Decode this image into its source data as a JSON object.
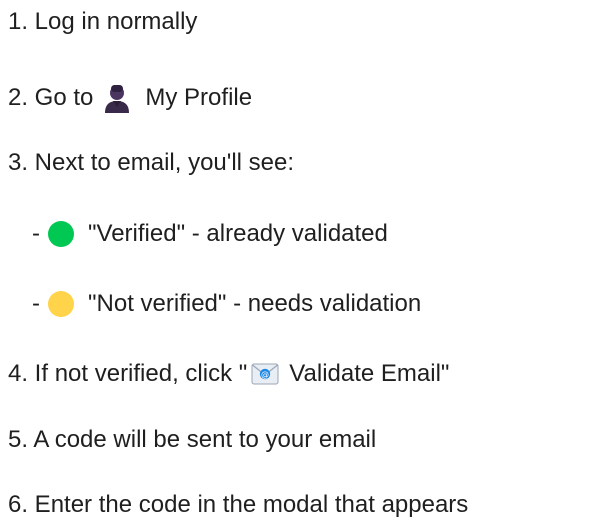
{
  "steps": [
    {
      "text": "1. Log in normally"
    },
    {
      "prefix": "2. Go to",
      "icon": "person-icon",
      "suffix": "My Profile"
    },
    {
      "text": "3. Next to email, you'll see:"
    },
    {
      "dash": "-",
      "icon": "green-dot-icon",
      "suffix": "\"Verified\" - already validated"
    },
    {
      "dash": "-",
      "icon": "yellow-dot-icon",
      "suffix": "\"Not verified\" - needs validation"
    },
    {
      "prefix": "4. If not verified, click \"",
      "icon": "envelope-icon",
      "suffix": "Validate Email\""
    },
    {
      "text": "5. A code will be sent to your email"
    },
    {
      "text": "6. Enter the code in the modal that appears"
    }
  ],
  "colors": {
    "verified": "#00c853",
    "not_verified": "#ffd34a"
  }
}
